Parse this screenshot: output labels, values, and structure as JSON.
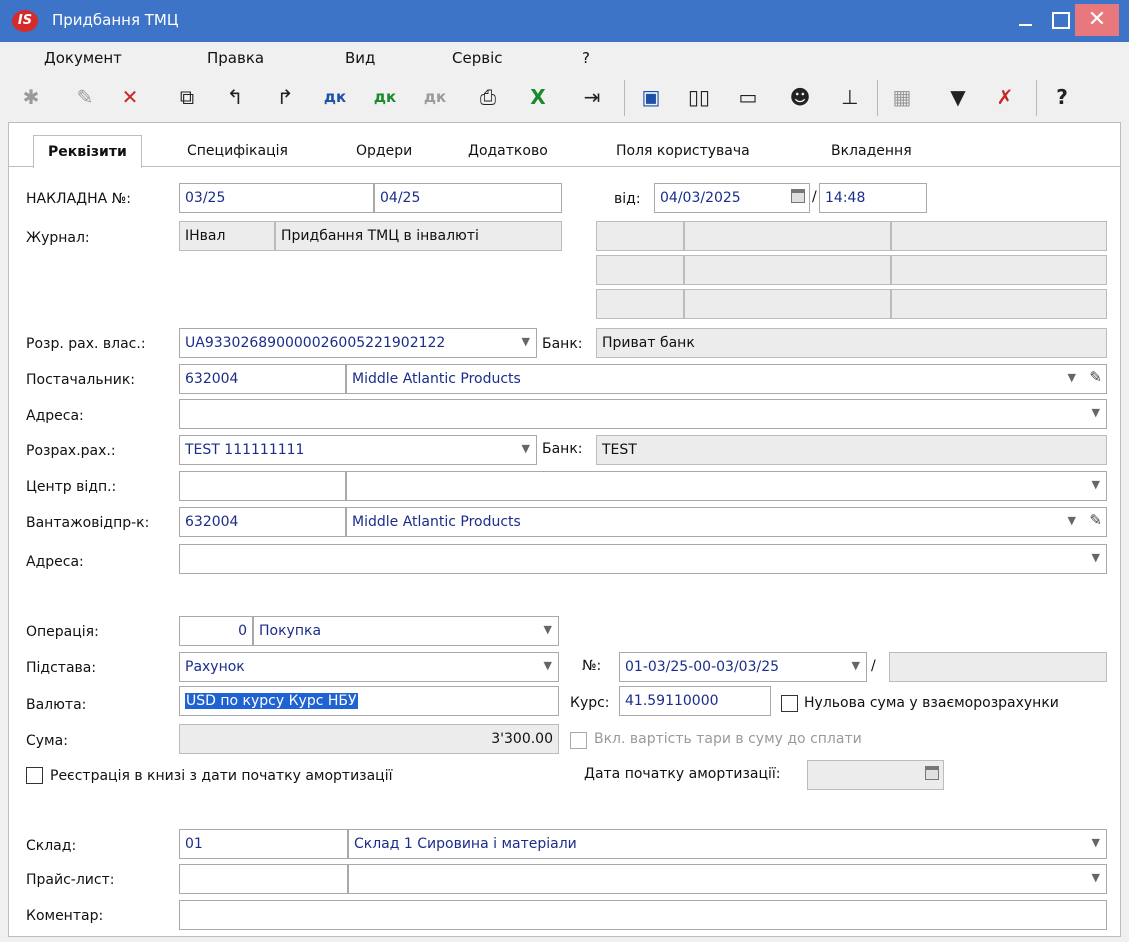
{
  "window": {
    "title": "Придбання ТМЦ",
    "logo": "IS",
    "close_glyph": "✕"
  },
  "menu": [
    "Документ",
    "Правка",
    "Вид",
    "Сервіс",
    "?"
  ],
  "toolbar_icons": [
    "add-icon",
    "edit-icon",
    "delete-icon",
    "copy-icon",
    "return-icon",
    "return-alt-icon",
    "debit-credit-icon",
    "debit-credit-green-icon",
    "debit-credit-disabled-icon",
    "print-icon",
    "export-excel-icon",
    "exit-icon",
    "save-icon",
    "book-icon",
    "folder-icon",
    "user-icon",
    "hierarchy-icon",
    "table-icon",
    "filter-icon",
    "filter-clear-icon",
    "help-icon"
  ],
  "tabs": [
    "Реквізити",
    "Специфікація",
    "Ордери",
    "Додатково",
    "Поля користувача",
    "Вкладення"
  ],
  "labels": {
    "invoice": "НАКЛАДНА №:",
    "journal": "Журнал:",
    "from": "від:",
    "own_account": "Розр. рах. влас.:",
    "bank": "Банк:",
    "supplier": "Постачальник:",
    "address": "Адреса:",
    "account": "Розрах.рах.:",
    "center": "Центр відп.:",
    "shipper": "Вантажовідпр-к:",
    "operation": "Операція:",
    "basis": "Підстава:",
    "number": "№:",
    "currency": "Валюта:",
    "rate": "Курс:",
    "sum": "Сума:",
    "zero_sum": "Нульова сума у взаєморозрахунки",
    "tare": "Вкл. вартість тари в суму до сплати",
    "registration": "Реєстрація в книзі з дати початку амортизації",
    "amort_date": "Дата початку амортизації:",
    "warehouse": "Склад:",
    "price_list": "Прайс-лист:",
    "comment": "Коментар:"
  },
  "values": {
    "invoice_no1": "03/25",
    "invoice_no2": "04/25",
    "date": "04/03/2025",
    "date_sep": "/",
    "time": "14:48",
    "journal_code": "ІНвал",
    "journal_name": "Придбання ТМЦ в інвалюті",
    "own_account": "UA933026890000026005221902122",
    "own_bank": "Приват банк",
    "supplier_code": "632004",
    "supplier_name": "Middle Atlantic Products",
    "account": "TEST 111111111",
    "account_bank": "TEST",
    "shipper_code": "632004",
    "shipper_name": "Middle Atlantic Products",
    "operation_code": "0",
    "operation_name": "Покупка",
    "basis": "Рахунок",
    "basis_no": "01-03/25-00-03/03/25",
    "basis_sep": "/",
    "currency": "USD по курсу Курс НБУ",
    "rate": "41.59110000",
    "sum": "3'300.00",
    "warehouse_code": "01",
    "warehouse_name": "Склад 1 Сировина і матеріали"
  }
}
